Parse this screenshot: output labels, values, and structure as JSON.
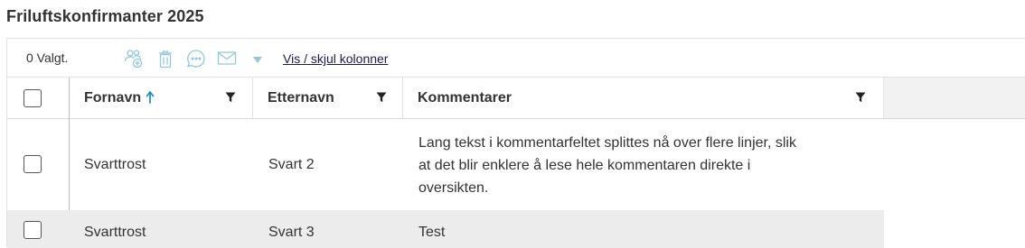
{
  "page": {
    "title": "Friluftskonfirmanter 2025"
  },
  "toolbar": {
    "selected_count": "0 Valgt.",
    "icons": [
      "add-users-icon",
      "trash-icon",
      "chat-bubble-icon",
      "mail-icon",
      "dropdown-caret-icon"
    ],
    "toggle_columns_label": "Vis / skjul kolonner"
  },
  "table": {
    "columns": [
      {
        "label": "Fornavn",
        "sorted": "ascending",
        "filter_icon": "filter-icon"
      },
      {
        "label": "Etternavn",
        "filter_icon": "filter-icon"
      },
      {
        "label": "Kommentarer",
        "filter_icon": "filter-icon"
      }
    ],
    "rows": [
      {
        "fornavn": "Svarttrost",
        "etternavn": "Svart 2",
        "kommentar_lines": [
          "Lang tekst i kommentarfeltet splittes nå over flere linjer, slik",
          "at det blir enklere å lese hele kommentaren direkte i",
          "oversikten."
        ]
      },
      {
        "fornavn": "Svarttrost",
        "etternavn": "Svart 3",
        "kommentar_lines": [
          "Test"
        ]
      }
    ]
  },
  "colors": {
    "icon": "#8ec9dc",
    "sort_arrow": "#1c8fc9",
    "link": "#1a1a55",
    "alt_row": "#ececec",
    "header_filler": "#f2f2f2"
  },
  "sort_arrow_glyph": "🠕"
}
